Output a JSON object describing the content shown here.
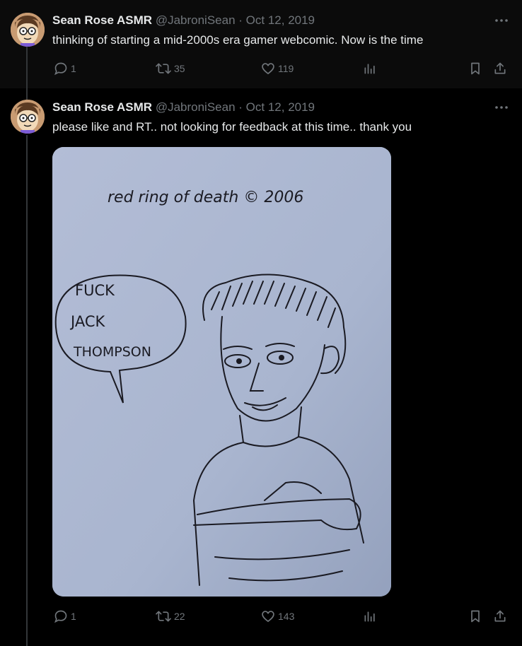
{
  "tweets": [
    {
      "author_name": "Sean Rose ASMR",
      "handle": "@JabroniSean",
      "separator": "·",
      "date": "Oct 12, 2019",
      "text": "thinking of starting a mid-2000s era gamer webcomic. Now is the time",
      "stats": {
        "replies": "1",
        "retweets": "35",
        "likes": "119"
      }
    },
    {
      "author_name": "Sean Rose ASMR",
      "handle": "@JabroniSean",
      "separator": "·",
      "date": "Oct 12, 2019",
      "text": "please like and RT.. not looking for feedback at this time.. thank you",
      "stats": {
        "replies": "1",
        "retweets": "22",
        "likes": "143"
      },
      "media": {
        "caption": "red ring of death © 2006",
        "speech_bubble": [
          "FUCK",
          "JACK",
          "THOMPSON"
        ]
      }
    }
  ],
  "colors": {
    "background": "#000000",
    "text": "#e7e9ea",
    "muted": "#71767b",
    "thread_line": "#333639"
  },
  "icons": [
    "more-icon",
    "reply-icon",
    "retweet-icon",
    "like-icon",
    "views-icon",
    "bookmark-icon",
    "share-icon"
  ]
}
